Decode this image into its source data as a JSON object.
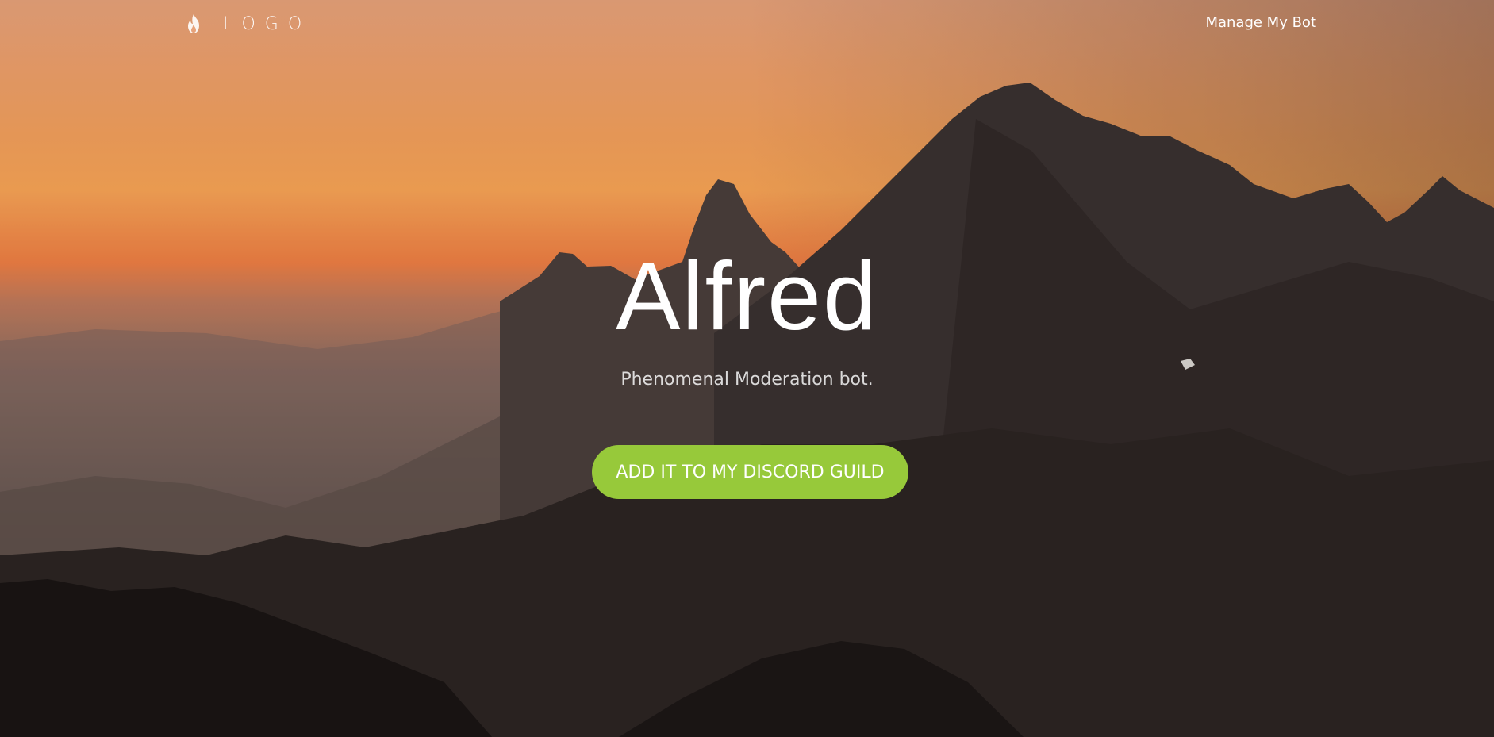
{
  "nav": {
    "logo_icon": "flame-icon",
    "logo_text": "LOGO",
    "manage_link": "Manage My Bot"
  },
  "hero": {
    "title": "Alfred",
    "tagline": "Phenomenal Moderation bot.",
    "cta_label": "ADD IT TO MY DISCORD GUILD",
    "background": "mountain sunset photo"
  },
  "colors": {
    "cta": "#97c93a",
    "sky_orange": "#f3a05c",
    "mountain_dark": "#2b2422"
  }
}
